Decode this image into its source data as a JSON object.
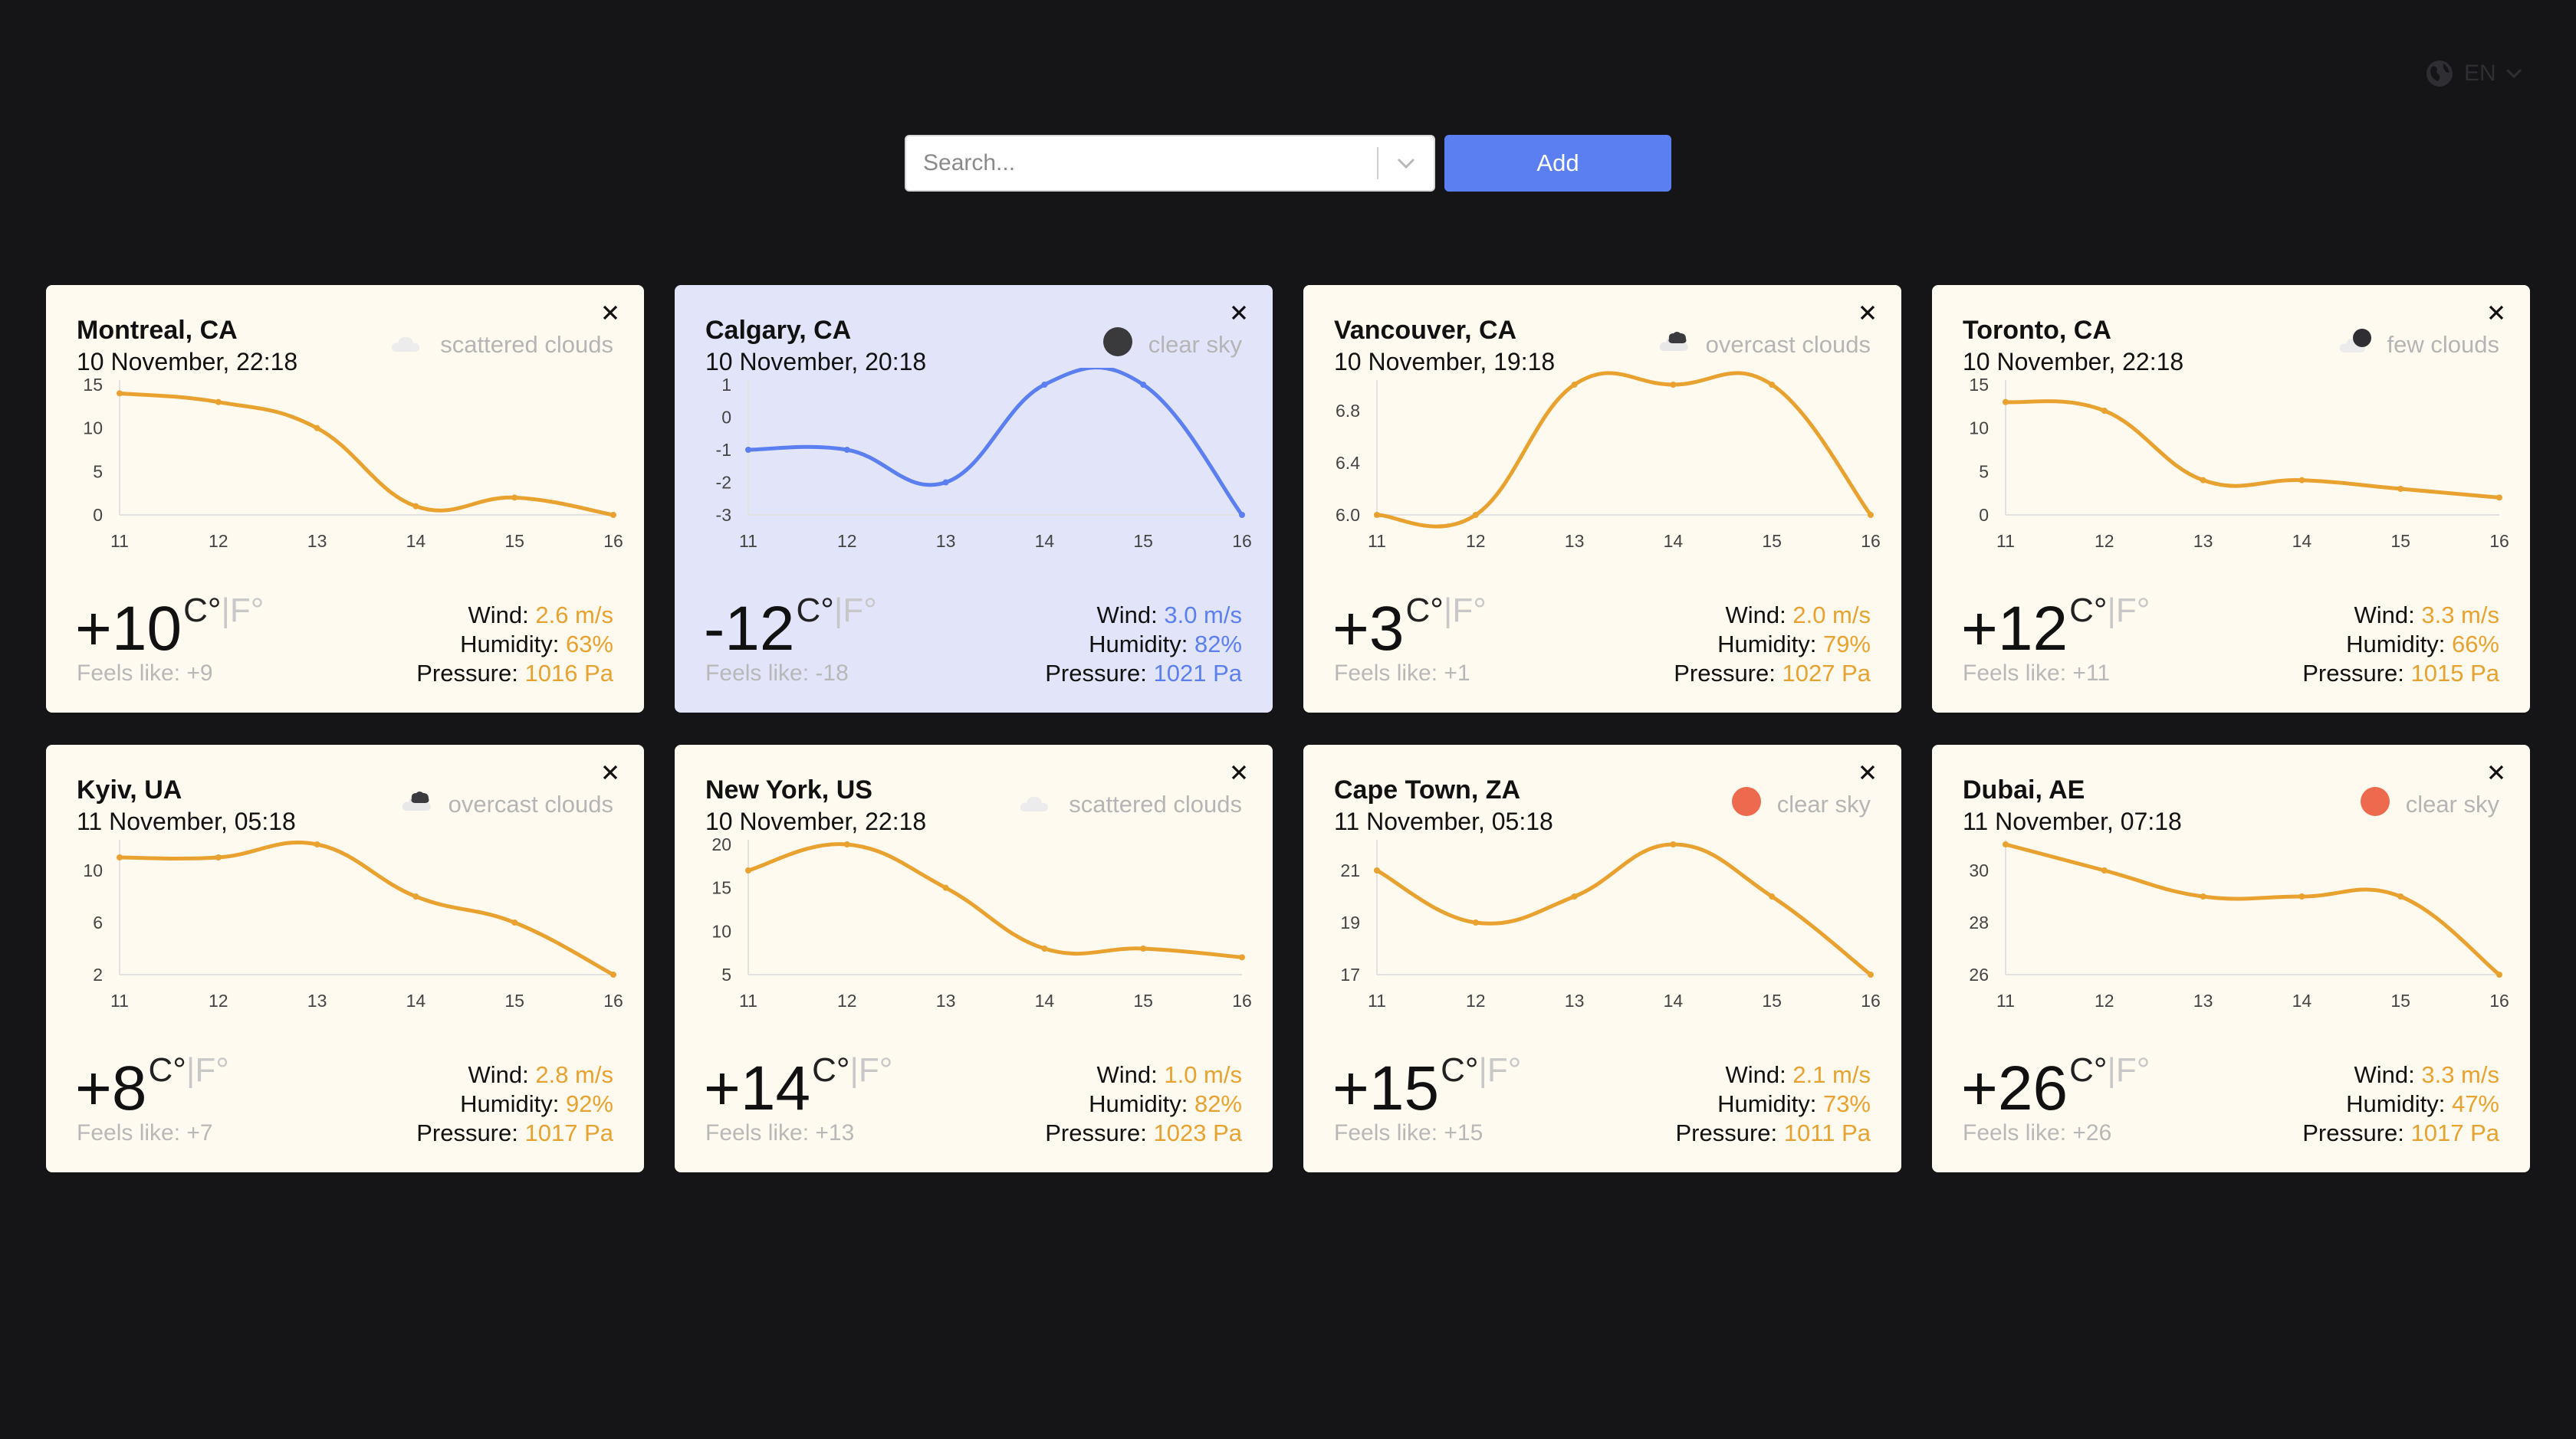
{
  "header": {
    "language": "EN"
  },
  "search": {
    "placeholder": "Search...",
    "add_label": "Add"
  },
  "labels": {
    "wind": "Wind:",
    "humidity": "Humidity:",
    "pressure": "Pressure:",
    "feels": "Feels like:",
    "unit_c": "C°",
    "unit_sep": "|",
    "unit_f": "F°"
  },
  "colors": {
    "warm_accent": "#e9a230",
    "cold_accent": "#5b7ff1",
    "card_warm": "#fffaf0",
    "card_cold": "#e2e4fa",
    "sun": "#ee6a4f",
    "moon": "#3a3a3d"
  },
  "cards": [
    {
      "city": "Montreal, CA",
      "date": "10 November, 22:18",
      "weather": "scattered clouds",
      "icon": "scattered-clouds-icon",
      "temp": "+10",
      "feels": "+9",
      "wind": "2.6 m/s",
      "humidity": "63%",
      "pressure": "1016 Pa",
      "theme": "warm"
    },
    {
      "city": "Calgary, CA",
      "date": "10 November, 20:18",
      "weather": "clear sky",
      "icon": "moon-icon",
      "temp": "-12",
      "feels": "-18",
      "wind": "3.0 m/s",
      "humidity": "82%",
      "pressure": "1021 Pa",
      "theme": "cold"
    },
    {
      "city": "Vancouver, CA",
      "date": "10 November, 19:18",
      "weather": "overcast clouds",
      "icon": "overcast-clouds-icon",
      "temp": "+3",
      "feels": "+1",
      "wind": "2.0 m/s",
      "humidity": "79%",
      "pressure": "1027 Pa",
      "theme": "warm"
    },
    {
      "city": "Toronto, CA",
      "date": "10 November, 22:18",
      "weather": "few clouds",
      "icon": "few-clouds-night-icon",
      "temp": "+12",
      "feels": "+11",
      "wind": "3.3 m/s",
      "humidity": "66%",
      "pressure": "1015 Pa",
      "theme": "warm"
    },
    {
      "city": "Kyiv, UA",
      "date": "11 November, 05:18",
      "weather": "overcast clouds",
      "icon": "overcast-clouds-icon",
      "temp": "+8",
      "feels": "+7",
      "wind": "2.8 m/s",
      "humidity": "92%",
      "pressure": "1017 Pa",
      "theme": "warm"
    },
    {
      "city": "New York, US",
      "date": "10 November, 22:18",
      "weather": "scattered clouds",
      "icon": "scattered-clouds-icon",
      "temp": "+14",
      "feels": "+13",
      "wind": "1.0 m/s",
      "humidity": "82%",
      "pressure": "1023 Pa",
      "theme": "warm"
    },
    {
      "city": "Cape Town, ZA",
      "date": "11 November, 05:18",
      "weather": "clear sky",
      "icon": "sun-icon",
      "temp": "+15",
      "feels": "+15",
      "wind": "2.1 m/s",
      "humidity": "73%",
      "pressure": "1011 Pa",
      "theme": "warm"
    },
    {
      "city": "Dubai, AE",
      "date": "11 November, 07:18",
      "weather": "clear sky",
      "icon": "sun-icon",
      "temp": "+26",
      "feels": "+26",
      "wind": "3.3 m/s",
      "humidity": "47%",
      "pressure": "1017 Pa",
      "theme": "warm"
    }
  ],
  "chart_data": [
    {
      "type": "line",
      "title": "",
      "x": [
        11,
        12,
        13,
        14,
        15,
        16
      ],
      "ylim": [
        0,
        15
      ],
      "yticks": [
        "0",
        "5",
        "10",
        "15"
      ],
      "series": [
        {
          "values": [
            14,
            13,
            10,
            1,
            2,
            0
          ]
        }
      ]
    },
    {
      "type": "line",
      "title": "",
      "x": [
        11,
        12,
        13,
        14,
        15,
        16
      ],
      "ylim": [
        -3,
        1
      ],
      "yticks": [
        "-3",
        "-2",
        "-1",
        "0",
        "1"
      ],
      "series": [
        {
          "values": [
            -1,
            -1,
            -2,
            1,
            1,
            -3
          ]
        }
      ]
    },
    {
      "type": "line",
      "title": "",
      "x": [
        11,
        12,
        13,
        14,
        15,
        16
      ],
      "ylim": [
        6.0,
        7.0
      ],
      "yticks": [
        "6.0",
        "6.4",
        "6.8"
      ],
      "series": [
        {
          "values": [
            6,
            6,
            7,
            7,
            7,
            6
          ]
        }
      ]
    },
    {
      "type": "line",
      "title": "",
      "x": [
        11,
        12,
        13,
        14,
        15,
        16
      ],
      "ylim": [
        0,
        15
      ],
      "yticks": [
        "0",
        "5",
        "10",
        "15"
      ],
      "series": [
        {
          "values": [
            13,
            12,
            4,
            4,
            3,
            2
          ]
        }
      ]
    },
    {
      "type": "line",
      "title": "",
      "x": [
        11,
        12,
        13,
        14,
        15,
        16
      ],
      "ylim": [
        2,
        12
      ],
      "yticks": [
        "2",
        "6",
        "10"
      ],
      "series": [
        {
          "values": [
            11,
            11,
            12,
            8,
            6,
            2
          ]
        }
      ]
    },
    {
      "type": "line",
      "title": "",
      "x": [
        11,
        12,
        13,
        14,
        15,
        16
      ],
      "ylim": [
        5,
        20
      ],
      "yticks": [
        "5",
        "10",
        "15",
        "20"
      ],
      "series": [
        {
          "values": [
            17,
            20,
            15,
            8,
            8,
            7
          ]
        }
      ]
    },
    {
      "type": "line",
      "title": "",
      "x": [
        11,
        12,
        13,
        14,
        15,
        16
      ],
      "ylim": [
        17,
        22
      ],
      "yticks": [
        "17",
        "19",
        "21"
      ],
      "series": [
        {
          "values": [
            21,
            19,
            20,
            22,
            20,
            17
          ]
        }
      ]
    },
    {
      "type": "line",
      "title": "",
      "x": [
        11,
        12,
        13,
        14,
        15,
        16
      ],
      "ylim": [
        26,
        31
      ],
      "yticks": [
        "26",
        "28",
        "30"
      ],
      "series": [
        {
          "values": [
            31,
            30,
            29,
            29,
            29,
            26
          ]
        }
      ]
    }
  ]
}
